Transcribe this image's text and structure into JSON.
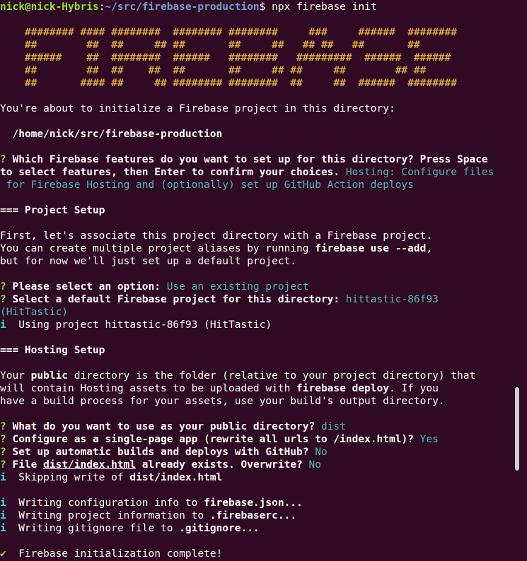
{
  "prompt": {
    "user_host": "nick@nick-Hybris",
    "colon": ":",
    "path": "~/src/firebase-production",
    "symbol": "$ ",
    "command": "npx firebase init"
  },
  "banner": [
    "    ######## #### ########  ######## ########     ###     ######  ########",
    "    ##        ##  ##     ## ##       ##     ##   ## ##   ##       ##",
    "    ######    ##  ########  ######   ########   #########  ######  ######",
    "    ##        ##  ##    ##  ##       ##     ## ##     ##        ## ##",
    "    ##       #### ##     ## ######## ########  ##     ##  ######  ########"
  ],
  "intro": "You're about to initialize a Firebase project in this directory:",
  "dir_path": "  /home/nick/src/firebase-production",
  "q1": {
    "mark": "? ",
    "text1": "Which Firebase features do you want to set up for this directory? Press Space",
    "text2": "to select features, then Enter to confirm your choices. ",
    "ans1": "Hosting: Configure files",
    "ans2": " for Firebase Hosting and (optionally) set up GitHub Action deploys"
  },
  "project_setup": "=== Project Setup",
  "assoc": {
    "l1": "First, let's associate this project directory with a Firebase project.",
    "l2a": "You can create multiple project aliases by running ",
    "l2b": "firebase use --add",
    "l2c": ",",
    "l3": "but for now we'll just set up a default project."
  },
  "q2": {
    "mark": "? ",
    "text": "Please select an option: ",
    "answer": "Use an existing project"
  },
  "q3": {
    "mark": "? ",
    "text": "Select a default Firebase project for this directory: ",
    "answer1": "hittastic-86f93",
    "answer2": "(HitTastic)"
  },
  "info_using": {
    "mark": "i",
    "text": "  Using project hittastic-86f93 (HitTastic)"
  },
  "hosting_setup": "=== Hosting Setup",
  "public_info": {
    "l1a": "Your ",
    "l1b": "public",
    "l1c": " directory is the folder (relative to your project directory) that",
    "l2a": "will contain Hosting assets to be uploaded with ",
    "l2b": "firebase deploy",
    "l2c": ". If you",
    "l3": "have a build process for your assets, use your build's output directory."
  },
  "q4": {
    "mark": "? ",
    "text": "What do you want to use as your public directory? ",
    "answer": "dist"
  },
  "q5": {
    "mark": "? ",
    "text": "Configure as a single-page app (rewrite all urls to /index.html)? ",
    "answer": "Yes"
  },
  "q6": {
    "mark": "? ",
    "text": "Set up automatic builds and deploys with GitHub? ",
    "answer": "No"
  },
  "q7": {
    "mark": "? ",
    "text_a": "File ",
    "file": "dist/index.html",
    "text_b": " already exists. Overwrite? ",
    "answer": "No"
  },
  "info_skip": {
    "mark": "i",
    "text": "  Skipping write of ",
    "file": "dist/index.html"
  },
  "info_config": {
    "mark": "i",
    "text": "  Writing configuration info to ",
    "file": "firebase.json..."
  },
  "info_project": {
    "mark": "i",
    "text": "  Writing project information to ",
    "file": ".firebaserc..."
  },
  "info_gitignore": {
    "mark": "i",
    "text": "  Writing gitignore file to ",
    "file": ".gitignore..."
  },
  "complete": {
    "mark": "✔",
    "text": "  Firebase initialization complete!"
  }
}
